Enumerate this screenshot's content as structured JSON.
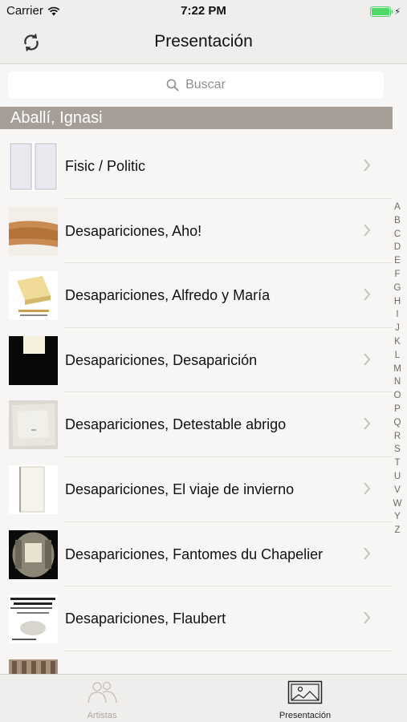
{
  "status_bar": {
    "carrier": "Carrier",
    "time": "7:22 PM",
    "battery_level": 1.0
  },
  "nav": {
    "title": "Presentación"
  },
  "search": {
    "placeholder": "Buscar"
  },
  "section": {
    "title": "Aballí, Ignasi"
  },
  "items": [
    {
      "label": "Fisic / Politic"
    },
    {
      "label": "Desapariciones, Aho!"
    },
    {
      "label": "Desapariciones, Alfredo y María"
    },
    {
      "label": "Desapariciones, Desaparición"
    },
    {
      "label": "Desapariciones, Detestable abrigo"
    },
    {
      "label": "Desapariciones, El viaje de invierno"
    },
    {
      "label": "Desapariciones, Fantomes du Chapelier"
    },
    {
      "label": "Desapariciones, Flaubert"
    },
    {
      "label": ""
    }
  ],
  "index_letters": [
    "A",
    "B",
    "C",
    "D",
    "E",
    "F",
    "G",
    "H",
    "I",
    "J",
    "K",
    "L",
    "M",
    "N",
    "O",
    "P",
    "Q",
    "R",
    "S",
    "T",
    "U",
    "V",
    "W",
    "Y",
    "Z"
  ],
  "tabs": [
    {
      "label": "Artistas",
      "icon": "people-icon",
      "active": false
    },
    {
      "label": "Presentación",
      "icon": "picture-icon",
      "active": true
    }
  ],
  "colors": {
    "accent": "#4cd964",
    "section_bg": "#a59e97",
    "bar_bg": "#efeeec"
  }
}
